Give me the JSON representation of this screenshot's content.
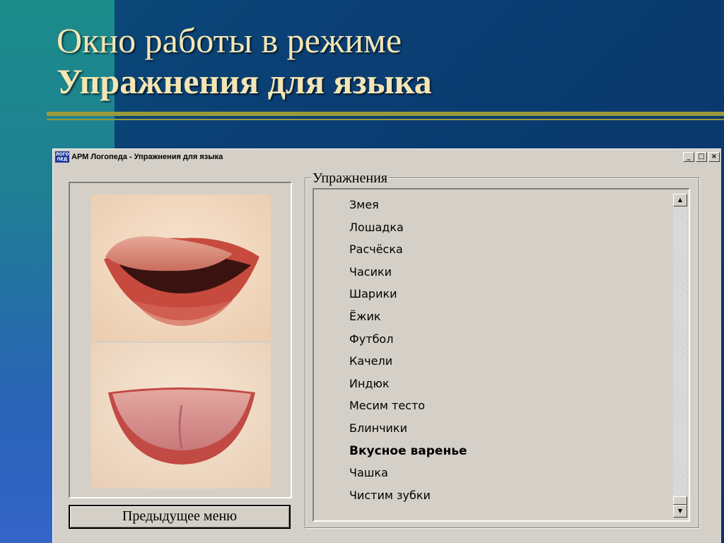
{
  "slide": {
    "title_line1": "Окно работы в режиме",
    "title_line2": "Упражнения для языка"
  },
  "window": {
    "icon_text_top": "ЛОГО",
    "icon_text_bottom": "ПЕД",
    "title": "АРМ Логопеда - Упражнения для языка",
    "minimize": "_",
    "maximize": "□",
    "close": "×"
  },
  "images": {
    "top": "tongue-licking-upper-lip-photo",
    "bottom": "tongue-extended-flat-photo"
  },
  "prev_button": {
    "label": "Предыдущее меню"
  },
  "exercises": {
    "group_label": "Упражнения",
    "items": [
      "Змея",
      "Лошадка",
      "Расчёска",
      "Часики",
      "Шарики",
      "Ёжик",
      "Футбол",
      "Качели",
      "Индюк",
      "Месим тесто",
      "Блинчики",
      "Вкусное варенье",
      "Чашка",
      "Чистим зубки"
    ],
    "selected": "Вкусное варенье"
  },
  "scrollbar": {
    "up": "▲",
    "down": "▼"
  },
  "colors": {
    "title_text": "#f3e6b4",
    "rule": "#9a9a3a",
    "window_face": "#d4d0c8"
  }
}
